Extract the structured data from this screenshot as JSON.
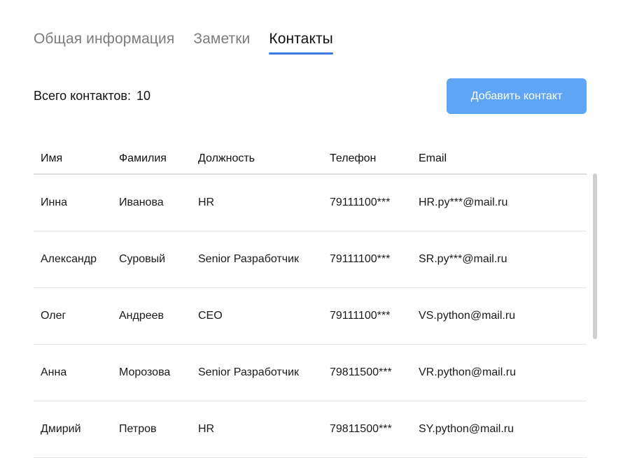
{
  "tabs": [
    {
      "label": "Общая информация",
      "active": false
    },
    {
      "label": "Заметки",
      "active": false
    },
    {
      "label": "Контакты",
      "active": true
    }
  ],
  "summary": {
    "label": "Всего контактов:",
    "count": "10"
  },
  "add_button": {
    "label": "Добавить контакт"
  },
  "table": {
    "headers": {
      "first_name": "Имя",
      "last_name": "Фамилия",
      "position": "Должность",
      "phone": "Телефон",
      "email": "Email"
    },
    "rows": [
      {
        "first_name": "Инна",
        "last_name": "Иванова",
        "position": "HR",
        "phone": "79111100***",
        "email": "HR.py***@mail.ru"
      },
      {
        "first_name": "Александр",
        "last_name": "Суровый",
        "position": "Senior Разработчик",
        "phone": "79111100***",
        "email": "SR.py***@mail.ru"
      },
      {
        "first_name": "Олег",
        "last_name": "Андреев",
        "position": "CEO",
        "phone": "79111100***",
        "email": "VS.python@mail.ru"
      },
      {
        "first_name": "Анна",
        "last_name": "Морозова",
        "position": "Senior Разработчик",
        "phone": "79811500***",
        "email": "VR.python@mail.ru"
      },
      {
        "first_name": "Дмирий",
        "last_name": "Петров",
        "position": "HR",
        "phone": "79811500***",
        "email": "SY.python@mail.ru"
      }
    ]
  },
  "colors": {
    "accent": "#3a7be0",
    "button": "#5ea6f5",
    "tab_inactive": "#7b7b80"
  }
}
